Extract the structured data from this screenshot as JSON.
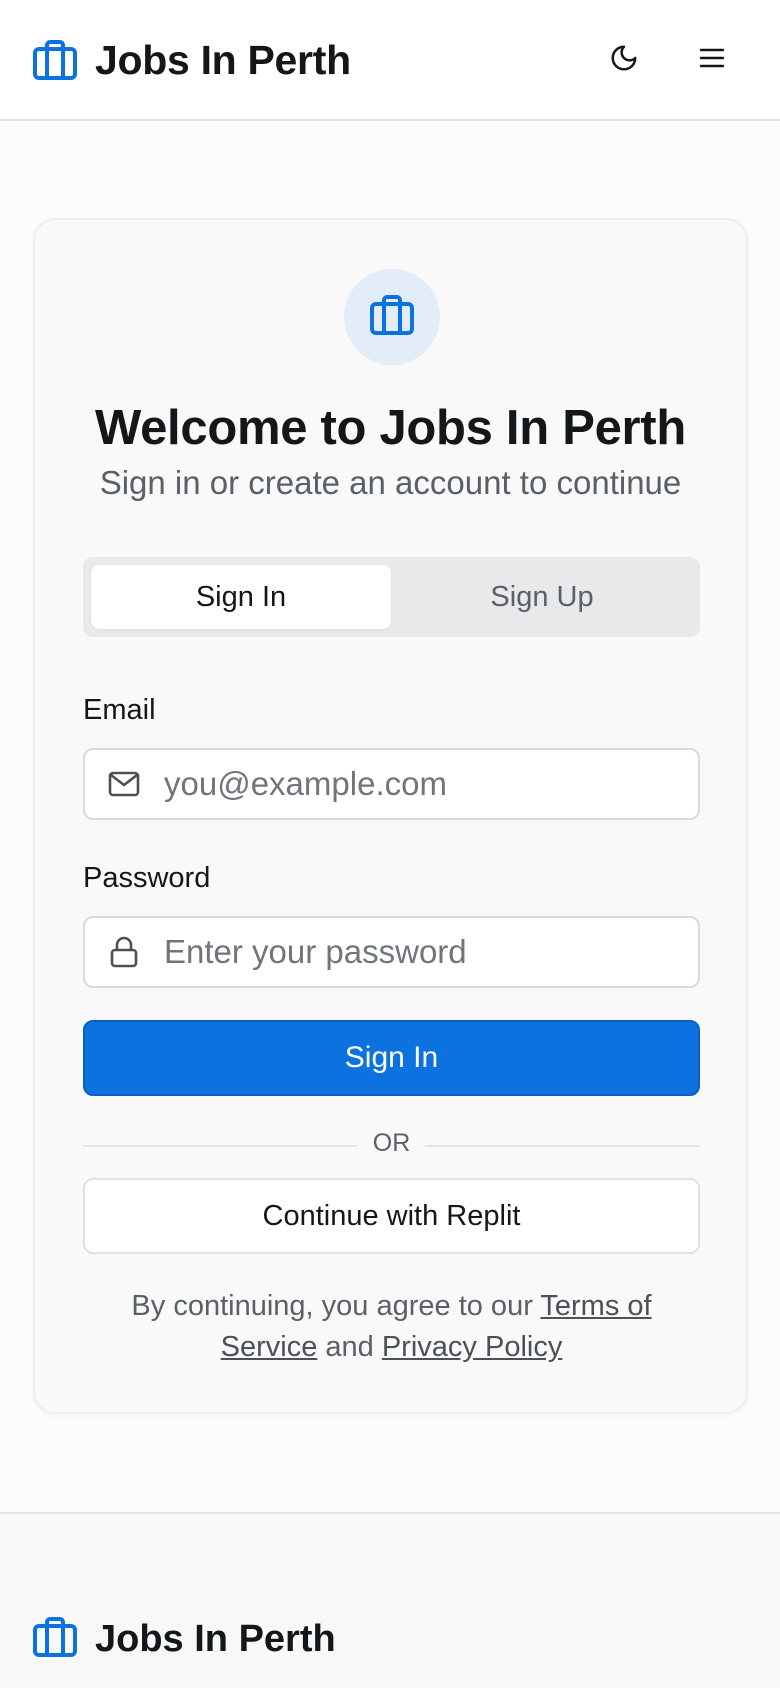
{
  "colors": {
    "accent": "#0b72e0",
    "icon_blue": "#0b72e0",
    "logo_bg": "#e3edf8"
  },
  "header": {
    "brand_name": "Jobs In Perth",
    "brand_icon": "briefcase-icon",
    "theme_toggle_icon": "moon-icon",
    "menu_icon": "hamburger-menu-icon"
  },
  "auth_card": {
    "logo_icon": "briefcase-icon",
    "title": "Welcome to Jobs In Perth",
    "subtitle": "Sign in or create an account to continue",
    "tabs": [
      {
        "label": "Sign In",
        "active": true
      },
      {
        "label": "Sign Up",
        "active": false
      }
    ],
    "email": {
      "label": "Email",
      "placeholder": "you@example.com",
      "value": "",
      "icon": "mail-icon"
    },
    "password": {
      "label": "Password",
      "placeholder": "Enter your password",
      "value": "",
      "icon": "lock-icon"
    },
    "submit_label": "Sign In",
    "divider_text": "OR",
    "replit_label": "Continue with Replit",
    "legal": {
      "prefix": "By continuing, you agree to our ",
      "terms_label": "Terms of Service",
      "joiner": " and ",
      "privacy_label": "Privacy Policy"
    }
  },
  "footer": {
    "brand_name": "Jobs In Perth",
    "brand_icon": "briefcase-icon"
  }
}
